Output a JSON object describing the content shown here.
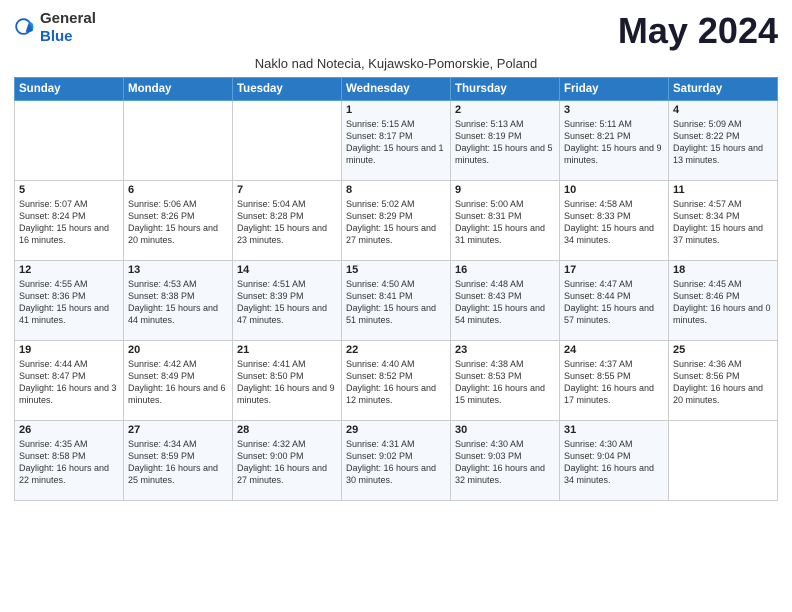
{
  "header": {
    "logo_general": "General",
    "logo_blue": "Blue",
    "month_title": "May 2024",
    "subtitle": "Naklo nad Notecia, Kujawsko-Pomorskie, Poland"
  },
  "days_of_week": [
    "Sunday",
    "Monday",
    "Tuesday",
    "Wednesday",
    "Thursday",
    "Friday",
    "Saturday"
  ],
  "weeks": [
    [
      {
        "day": "",
        "info": ""
      },
      {
        "day": "",
        "info": ""
      },
      {
        "day": "",
        "info": ""
      },
      {
        "day": "1",
        "info": "Sunrise: 5:15 AM\nSunset: 8:17 PM\nDaylight: 15 hours\nand 1 minute."
      },
      {
        "day": "2",
        "info": "Sunrise: 5:13 AM\nSunset: 8:19 PM\nDaylight: 15 hours\nand 5 minutes."
      },
      {
        "day": "3",
        "info": "Sunrise: 5:11 AM\nSunset: 8:21 PM\nDaylight: 15 hours\nand 9 minutes."
      },
      {
        "day": "4",
        "info": "Sunrise: 5:09 AM\nSunset: 8:22 PM\nDaylight: 15 hours\nand 13 minutes."
      }
    ],
    [
      {
        "day": "5",
        "info": "Sunrise: 5:07 AM\nSunset: 8:24 PM\nDaylight: 15 hours\nand 16 minutes."
      },
      {
        "day": "6",
        "info": "Sunrise: 5:06 AM\nSunset: 8:26 PM\nDaylight: 15 hours\nand 20 minutes."
      },
      {
        "day": "7",
        "info": "Sunrise: 5:04 AM\nSunset: 8:28 PM\nDaylight: 15 hours\nand 23 minutes."
      },
      {
        "day": "8",
        "info": "Sunrise: 5:02 AM\nSunset: 8:29 PM\nDaylight: 15 hours\nand 27 minutes."
      },
      {
        "day": "9",
        "info": "Sunrise: 5:00 AM\nSunset: 8:31 PM\nDaylight: 15 hours\nand 31 minutes."
      },
      {
        "day": "10",
        "info": "Sunrise: 4:58 AM\nSunset: 8:33 PM\nDaylight: 15 hours\nand 34 minutes."
      },
      {
        "day": "11",
        "info": "Sunrise: 4:57 AM\nSunset: 8:34 PM\nDaylight: 15 hours\nand 37 minutes."
      }
    ],
    [
      {
        "day": "12",
        "info": "Sunrise: 4:55 AM\nSunset: 8:36 PM\nDaylight: 15 hours\nand 41 minutes."
      },
      {
        "day": "13",
        "info": "Sunrise: 4:53 AM\nSunset: 8:38 PM\nDaylight: 15 hours\nand 44 minutes."
      },
      {
        "day": "14",
        "info": "Sunrise: 4:51 AM\nSunset: 8:39 PM\nDaylight: 15 hours\nand 47 minutes."
      },
      {
        "day": "15",
        "info": "Sunrise: 4:50 AM\nSunset: 8:41 PM\nDaylight: 15 hours\nand 51 minutes."
      },
      {
        "day": "16",
        "info": "Sunrise: 4:48 AM\nSunset: 8:43 PM\nDaylight: 15 hours\nand 54 minutes."
      },
      {
        "day": "17",
        "info": "Sunrise: 4:47 AM\nSunset: 8:44 PM\nDaylight: 15 hours\nand 57 minutes."
      },
      {
        "day": "18",
        "info": "Sunrise: 4:45 AM\nSunset: 8:46 PM\nDaylight: 16 hours\nand 0 minutes."
      }
    ],
    [
      {
        "day": "19",
        "info": "Sunrise: 4:44 AM\nSunset: 8:47 PM\nDaylight: 16 hours\nand 3 minutes."
      },
      {
        "day": "20",
        "info": "Sunrise: 4:42 AM\nSunset: 8:49 PM\nDaylight: 16 hours\nand 6 minutes."
      },
      {
        "day": "21",
        "info": "Sunrise: 4:41 AM\nSunset: 8:50 PM\nDaylight: 16 hours\nand 9 minutes."
      },
      {
        "day": "22",
        "info": "Sunrise: 4:40 AM\nSunset: 8:52 PM\nDaylight: 16 hours\nand 12 minutes."
      },
      {
        "day": "23",
        "info": "Sunrise: 4:38 AM\nSunset: 8:53 PM\nDaylight: 16 hours\nand 15 minutes."
      },
      {
        "day": "24",
        "info": "Sunrise: 4:37 AM\nSunset: 8:55 PM\nDaylight: 16 hours\nand 17 minutes."
      },
      {
        "day": "25",
        "info": "Sunrise: 4:36 AM\nSunset: 8:56 PM\nDaylight: 16 hours\nand 20 minutes."
      }
    ],
    [
      {
        "day": "26",
        "info": "Sunrise: 4:35 AM\nSunset: 8:58 PM\nDaylight: 16 hours\nand 22 minutes."
      },
      {
        "day": "27",
        "info": "Sunrise: 4:34 AM\nSunset: 8:59 PM\nDaylight: 16 hours\nand 25 minutes."
      },
      {
        "day": "28",
        "info": "Sunrise: 4:32 AM\nSunset: 9:00 PM\nDaylight: 16 hours\nand 27 minutes."
      },
      {
        "day": "29",
        "info": "Sunrise: 4:31 AM\nSunset: 9:02 PM\nDaylight: 16 hours\nand 30 minutes."
      },
      {
        "day": "30",
        "info": "Sunrise: 4:30 AM\nSunset: 9:03 PM\nDaylight: 16 hours\nand 32 minutes."
      },
      {
        "day": "31",
        "info": "Sunrise: 4:30 AM\nSunset: 9:04 PM\nDaylight: 16 hours\nand 34 minutes."
      },
      {
        "day": "",
        "info": ""
      }
    ]
  ]
}
